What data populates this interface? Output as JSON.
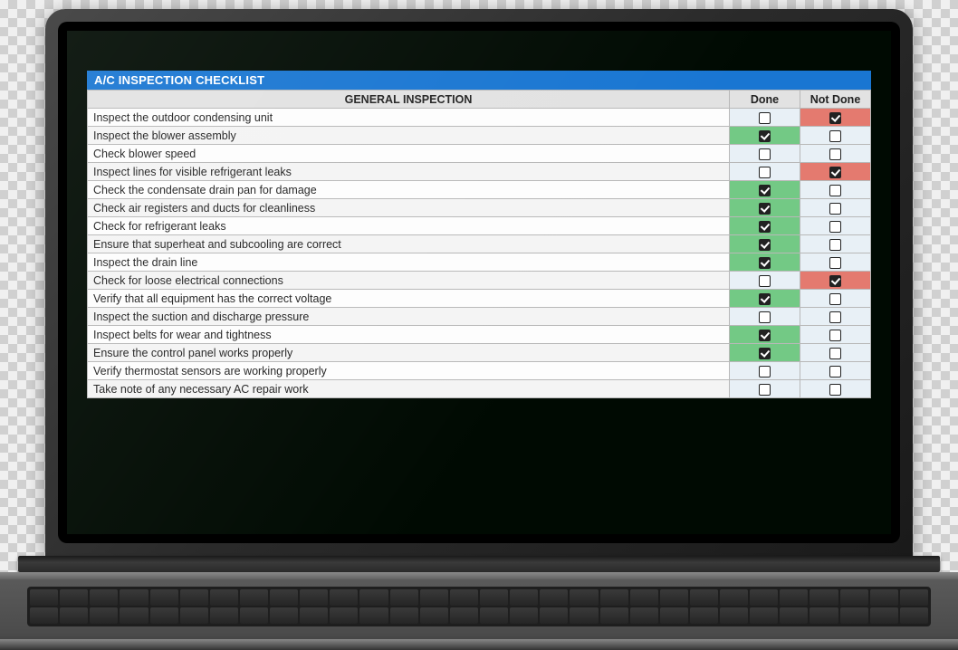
{
  "title": "A/C INSPECTION CHECKLIST",
  "section_header": "GENERAL INSPECTION",
  "columns": {
    "done": "Done",
    "notdone": "Not Done"
  },
  "rows": [
    {
      "task": "Inspect the outdoor condensing unit",
      "done": false,
      "not_done": true
    },
    {
      "task": "Inspect the blower assembly",
      "done": true,
      "not_done": false
    },
    {
      "task": "Check blower speed",
      "done": false,
      "not_done": false
    },
    {
      "task": "Inspect lines for visible refrigerant leaks",
      "done": false,
      "not_done": true
    },
    {
      "task": "Check the condensate drain pan for damage",
      "done": true,
      "not_done": false
    },
    {
      "task": "Check air registers and ducts for cleanliness",
      "done": true,
      "not_done": false
    },
    {
      "task": "Check for refrigerant leaks",
      "done": true,
      "not_done": false
    },
    {
      "task": "Ensure that superheat and subcooling are correct",
      "done": true,
      "not_done": false
    },
    {
      "task": "Inspect the drain line",
      "done": true,
      "not_done": false
    },
    {
      "task": "Check for loose electrical connections",
      "done": false,
      "not_done": true
    },
    {
      "task": "Verify that all equipment has the correct voltage",
      "done": true,
      "not_done": false
    },
    {
      "task": "Inspect the suction and discharge pressure",
      "done": false,
      "not_done": false
    },
    {
      "task": "Inspect belts for wear and tightness",
      "done": true,
      "not_done": false
    },
    {
      "task": "Ensure the control panel works properly",
      "done": true,
      "not_done": false
    },
    {
      "task": "Verify thermostat sensors are working properly",
      "done": false,
      "not_done": false
    },
    {
      "task": "Take note of any necessary AC repair work",
      "done": false,
      "not_done": false
    }
  ],
  "colors": {
    "title_bg": "#1976d2",
    "done_fill": "#73c985",
    "notdone_fill": "#e47a6f",
    "cell_bg": "#e8f0f6"
  }
}
